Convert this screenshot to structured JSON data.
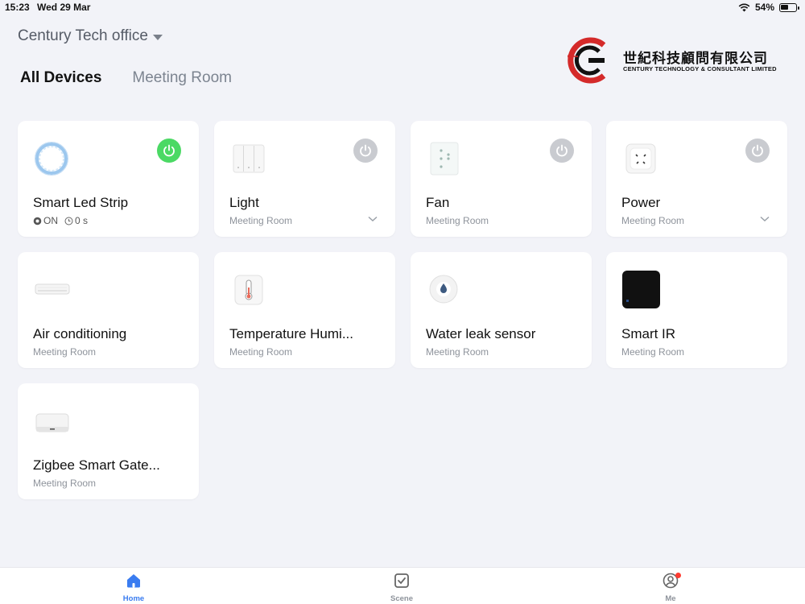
{
  "status_bar": {
    "time": "15:23",
    "date": "Wed 29 Mar",
    "battery": "54%",
    "battery_level": 0.54
  },
  "header": {
    "home_name": "Century Tech office",
    "tabs": [
      {
        "label": "All Devices",
        "active": true
      },
      {
        "label": "Meeting Room",
        "active": false
      }
    ]
  },
  "logo": {
    "chinese_name": "世紀科技顧問有限公司",
    "english_name": "CENTURY TECHNOLOGY & CONSULTANT LIMITED"
  },
  "devices": [
    {
      "name": "Smart Led Strip",
      "status_on": "ON",
      "timer": "0 s",
      "power": "on",
      "icon": "led-strip-icon"
    },
    {
      "name": "Light",
      "room": "Meeting Room",
      "power": "off",
      "expandable": true,
      "icon": "light-switch-icon"
    },
    {
      "name": "Fan",
      "room": "Meeting Room",
      "power": "off",
      "icon": "fan-switch-icon"
    },
    {
      "name": "Power",
      "room": "Meeting Room",
      "power": "off",
      "expandable": true,
      "icon": "power-socket-icon"
    },
    {
      "name": "Air conditioning",
      "room": "Meeting Room",
      "icon": "air-conditioner-icon"
    },
    {
      "name": "Temperature Humi...",
      "room": "Meeting Room",
      "icon": "thermometer-icon"
    },
    {
      "name": "Water leak sensor",
      "room": "Meeting Room",
      "icon": "water-drop-icon"
    },
    {
      "name": "Smart IR",
      "room": "Meeting Room",
      "icon": "ir-remote-icon"
    },
    {
      "name": "Zigbee Smart Gate...",
      "room": "Meeting Room",
      "icon": "gateway-icon"
    }
  ],
  "colors": {
    "power_on": "#4bd964",
    "power_off": "#c9cbd0",
    "accent": "#3a7cf0",
    "notification": "#ff3b30"
  },
  "tabbar": {
    "items": [
      {
        "label": "Home",
        "icon": "home-icon",
        "active": true
      },
      {
        "label": "Scene",
        "icon": "scene-icon",
        "active": false
      },
      {
        "label": "Me",
        "icon": "profile-icon",
        "active": false,
        "badge": true
      }
    ]
  }
}
